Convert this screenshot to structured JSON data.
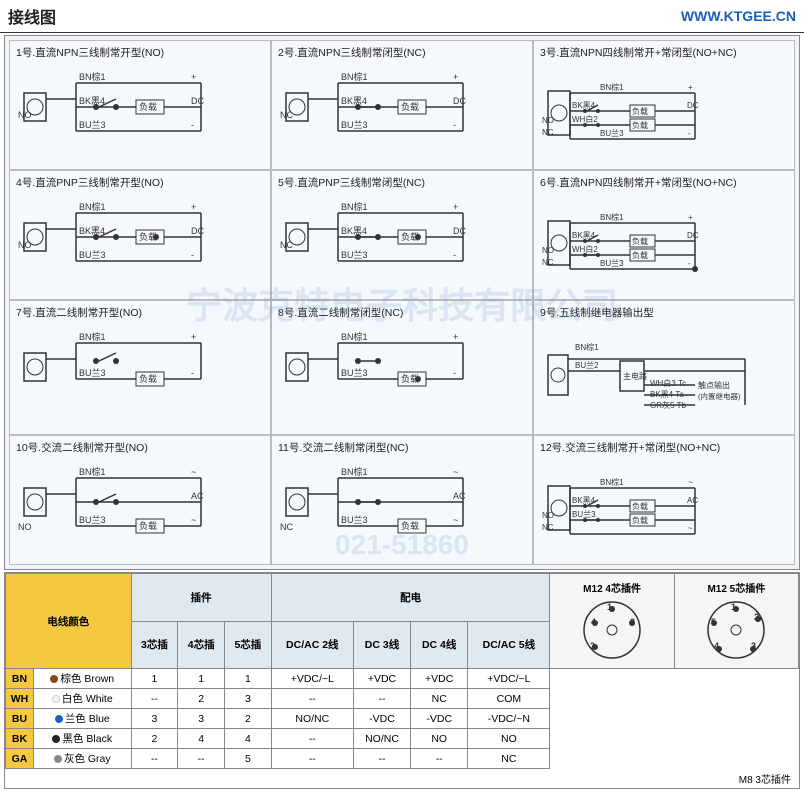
{
  "header": {
    "title": "接线图",
    "url": "WWW.KTGEE.CN"
  },
  "diagrams": [
    {
      "id": 1,
      "title": "1号.直流NPN三线制常开型(NO)",
      "type": "npn3-no"
    },
    {
      "id": 2,
      "title": "2号.直流NPN三线制常闭型(NC)",
      "type": "npn3-nc"
    },
    {
      "id": 3,
      "title": "3号.直流NPN四线制常开+常闭型(NO+NC)",
      "type": "npn4-nonc"
    },
    {
      "id": 4,
      "title": "4号.直流PNP三线制常开型(NO)",
      "type": "pnp3-no"
    },
    {
      "id": 5,
      "title": "5号.直流PNP三线制常闭型(NC)",
      "type": "pnp3-nc"
    },
    {
      "id": 6,
      "title": "6号.直流NPN四线制常开+常闭型(NO+NC)",
      "type": "npn4-nonc2"
    },
    {
      "id": 7,
      "title": "7号.直流二线制常开型(NO)",
      "type": "dc2-no"
    },
    {
      "id": 8,
      "title": "8号.直流二线制常闭型(NC)",
      "type": "dc2-nc"
    },
    {
      "id": 9,
      "title": "9号.五线制继电器输出型",
      "type": "relay5"
    },
    {
      "id": 10,
      "title": "10号.交流二线制常开型(NO)",
      "type": "ac2-no"
    },
    {
      "id": 11,
      "title": "11号.交流二线制常闭型(NC)",
      "type": "ac2-nc"
    },
    {
      "id": 12,
      "title": "12号.交流三线制常开+常闭型(NO+NC)",
      "type": "ac3-nonc"
    }
  ],
  "table": {
    "wire_color_header": "电线颜色",
    "plugin_header": "插件",
    "power_header": "配电",
    "m12_4pin_header": "M12 4芯插件",
    "m12_5pin_header": "M12 5芯插件",
    "plugin_cols": [
      "3芯插",
      "4芯插",
      "5芯插"
    ],
    "power_cols": [
      "DC/AC 2线",
      "DC 3线",
      "DC 4线",
      "DC/AC 5线"
    ],
    "rows": [
      {
        "abbr": "BN",
        "name": "棕色 Brown",
        "color": "bn",
        "plugin": [
          "1",
          "1",
          "1"
        ],
        "power": [
          "+VDC/~L",
          "+VDC",
          "+VDC",
          "+VDC/~L"
        ]
      },
      {
        "abbr": "WH",
        "name": "白色 White",
        "color": "wh",
        "plugin": [
          "--",
          "2",
          "3"
        ],
        "power": [
          "--",
          "--",
          "NC",
          "COM"
        ]
      },
      {
        "abbr": "BU",
        "name": "兰色 Blue",
        "color": "bu",
        "plugin": [
          "3",
          "3",
          "2"
        ],
        "power": [
          "NO/NC",
          "-VDC",
          "-VDC",
          "-VDC/~N"
        ]
      },
      {
        "abbr": "BK",
        "name": "黑色 Black",
        "color": "bk",
        "plugin": [
          "2",
          "4",
          "4"
        ],
        "power": [
          "--",
          "NO/NC",
          "NO",
          "NO"
        ]
      },
      {
        "abbr": "GA",
        "name": "灰色 Gray",
        "color": "ga",
        "plugin": [
          "--",
          "--",
          "5"
        ],
        "power": [
          "--",
          "--",
          "--",
          "NC"
        ]
      }
    ],
    "m8_label": "M8 3芯插件"
  }
}
